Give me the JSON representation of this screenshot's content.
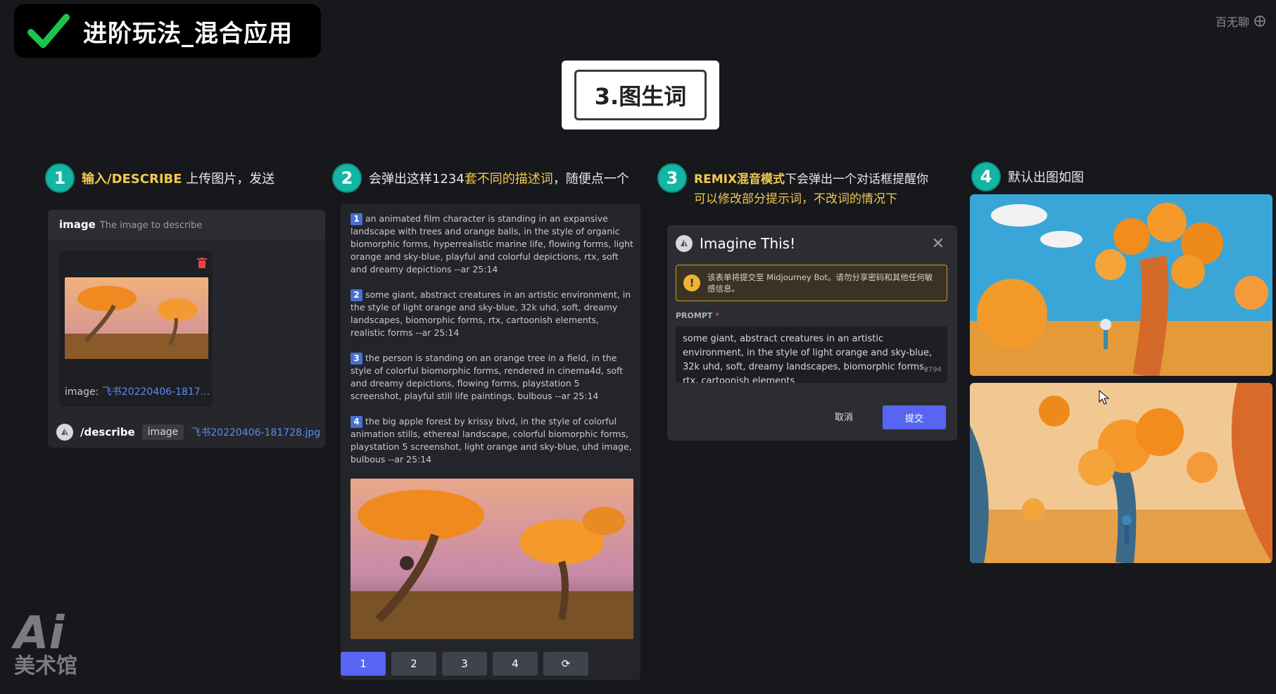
{
  "banner": {
    "title": "进阶玩法_混合应用",
    "icon": "check-icon"
  },
  "watermark_top": "百无聊",
  "center_title": "3.图生词",
  "steps": [
    {
      "num": "1",
      "highlight": "输入/DESCRIBE",
      "text": " 上传图片，发送"
    },
    {
      "num": "2",
      "pre": "会弹出这样1234",
      "highlight": "套不同的描述词",
      "text": "，随便点一个"
    },
    {
      "num": "3",
      "highlight": "REMIX混音模式",
      "text": "下会弹出一个对话框提醒你",
      "line2": "可以修改部分提示词，不改词的情况下"
    },
    {
      "num": "4",
      "text": "默认出图如图"
    }
  ],
  "panel1": {
    "param_name": "image",
    "param_desc": "The image to describe",
    "image_label": "image: ",
    "image_link": "飞书20220406-1817...",
    "command": "/describe",
    "chip": "image",
    "file": "飞书20220406-181728.jpg"
  },
  "descriptions": [
    {
      "n": "1",
      "text": "an animated film character is standing in an expansive landscape with trees and orange balls, in the style of organic biomorphic forms, hyperrealistic marine life, flowing forms, light orange and sky-blue, playful and colorful depictions, rtx, soft and dreamy depictions --ar 25:14"
    },
    {
      "n": "2",
      "text": "some giant, abstract creatures in an artistic environment, in the style of light orange and sky-blue, 32k uhd, soft, dreamy landscapes, biomorphic forms, rtx, cartoonish elements, realistic forms --ar 25:14"
    },
    {
      "n": "3",
      "text": "the person is standing on an orange tree in a field, in the style of colorful biomorphic forms, rendered in cinema4d, soft and dreamy depictions, flowing forms, playstation 5 screenshot, playful still life paintings, bulbous --ar 25:14"
    },
    {
      "n": "4",
      "text": "the big apple forest by krissy blvd, in the style of colorful animation stills, ethereal landscape, colorful biomorphic forms, playstation 5 screenshot, light orange and sky-blue, uhd image, bulbous --ar 25:14"
    }
  ],
  "buttons": [
    "1",
    "2",
    "3",
    "4",
    "⟳"
  ],
  "dialog": {
    "title": "Imagine This!",
    "close": "✕",
    "warning": "该表单将提交至 Midjourney Bot。请勿分享密码和其他任何敏感信息。",
    "prompt_label": "PROMPT",
    "prompt_required": "*",
    "prompt_value": "some giant, abstract creatures in an artistic environment, in the style of light orange and sky-blue, 32k uhd, soft, dreamy landscapes, biomorphic forms, rtx, cartoonish elements",
    "char_count": "3794",
    "cancel": "取消",
    "submit": "提交"
  },
  "logo_watermark": {
    "top": "Ai",
    "bottom": "美术馆"
  },
  "colors": {
    "accent": "#5865f2",
    "step_badge": "#13b5a3",
    "highlight": "#f2c94c"
  }
}
